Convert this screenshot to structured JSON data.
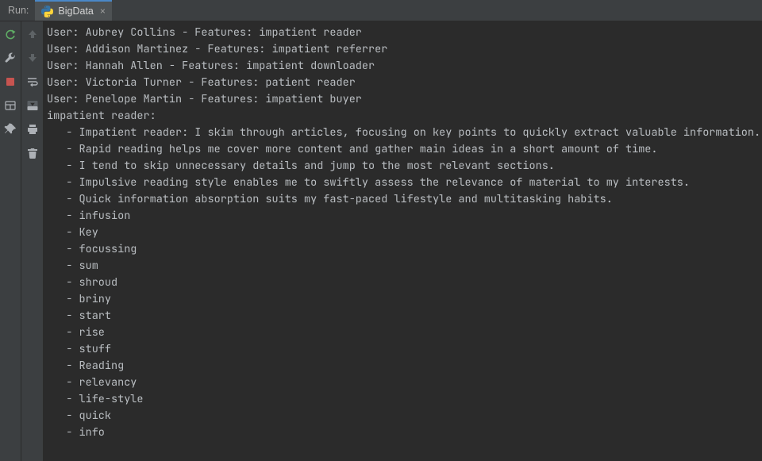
{
  "header": {
    "run_label": "Run:",
    "tab": {
      "name": "BigData",
      "close": "×"
    }
  },
  "left_tools": [
    {
      "name": "rerun-icon",
      "title": "Rerun"
    },
    {
      "name": "wrench-icon",
      "title": "Modify Run Configuration"
    },
    {
      "name": "stop-icon",
      "title": "Stop"
    },
    {
      "name": "layout-icon",
      "title": "Layout"
    },
    {
      "name": "pin-icon",
      "title": "Pin Tab"
    }
  ],
  "gutter_tools": [
    {
      "name": "arrow-up-icon",
      "title": "Up the Stack Trace",
      "disabled": true
    },
    {
      "name": "arrow-down-icon",
      "title": "Down the Stack Trace",
      "disabled": true
    },
    {
      "name": "soft-wrap-icon",
      "title": "Soft-Wrap"
    },
    {
      "name": "scroll-end-icon",
      "title": "Scroll to End"
    },
    {
      "name": "print-icon",
      "title": "Print"
    },
    {
      "name": "trash-icon",
      "title": "Clear All"
    }
  ],
  "console_lines": [
    "User: Aubrey Collins - Features: impatient reader",
    "User: Addison Martinez - Features: impatient referrer",
    "User: Hannah Allen - Features: impatient downloader",
    "User: Victoria Turner - Features: patient reader",
    "User: Penelope Martin - Features: impatient buyer",
    "impatient reader:",
    "   - Impatient reader: I skim through articles, focusing on key points to quickly extract valuable information.",
    "   - Rapid reading helps me cover more content and gather main ideas in a short amount of time.",
    "   - I tend to skip unnecessary details and jump to the most relevant sections.",
    "   - Impulsive reading style enables me to swiftly assess the relevance of material to my interests.",
    "   - Quick information absorption suits my fast-paced lifestyle and multitasking habits.",
    "   - infusion",
    "   - Key",
    "   - focussing",
    "   - sum",
    "   - shroud",
    "   - briny",
    "   - start",
    "   - rise",
    "   - stuff",
    "   - Reading",
    "   - relevancy",
    "   - life-style",
    "   - quick",
    "   - info"
  ]
}
